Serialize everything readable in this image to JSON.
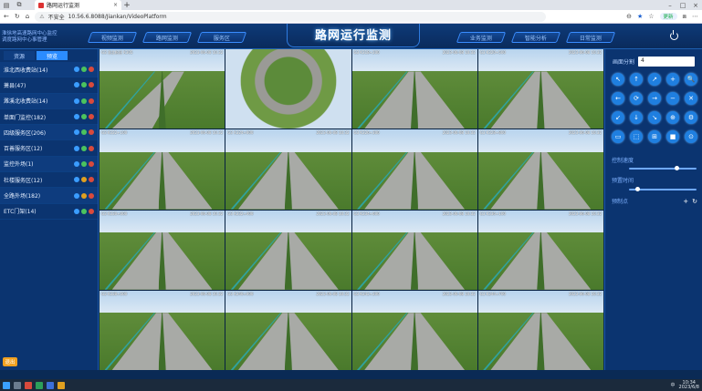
{
  "browser": {
    "tab_title": "路网运行监测",
    "security_label": "不安全",
    "url": "10.56.6.8088/Jiankan/VideoPlatform",
    "sync_pill": "更新"
  },
  "header": {
    "org_line1": "淮徐地高速路网中心监控",
    "org_line2": "调度路网中心事管理",
    "title": "路网运行监测",
    "nav_left": [
      "视频监测",
      "路网监测",
      "服务区"
    ],
    "nav_right": [
      "业务监测",
      "智能分析",
      "日常监测"
    ]
  },
  "sidebar": {
    "tabs": [
      "资源",
      "预览"
    ],
    "active_tab": "预览",
    "groups": [
      {
        "label": "淮北西收费站(14)",
        "dots": [
          "b",
          "g",
          "r"
        ]
      },
      {
        "label": "萧县(47)",
        "dots": [
          "b",
          "g",
          "r"
        ]
      },
      {
        "label": "濉溪北收费站(14)",
        "dots": [
          "b",
          "g",
          "r"
        ]
      },
      {
        "label": "单面门监控(182)",
        "dots": [
          "b",
          "g",
          "r"
        ]
      },
      {
        "label": "四级服务区(206)",
        "dots": [
          "b",
          "g",
          "r"
        ]
      },
      {
        "label": "百善服务区(12)",
        "dots": [
          "b",
          "g",
          "r"
        ]
      },
      {
        "label": "监控外场(1)",
        "dots": [
          "b",
          "g",
          "r"
        ]
      },
      {
        "label": "杜楼服务区(12)",
        "dots": [
          "b",
          "y",
          "r"
        ]
      },
      {
        "label": "全路外场(182)",
        "dots": [
          "b",
          "y",
          "r"
        ]
      },
      {
        "label": "ETC门架(14)",
        "dots": [
          "b",
          "g",
          "r"
        ]
      }
    ],
    "exit_label": "退出"
  },
  "cameras": [
    {
      "label": "G3 淮北枢纽 K305",
      "time": "2023-06-08 10:32",
      "style": "curve"
    },
    {
      "label": "",
      "time": "",
      "style": "fisheye"
    },
    {
      "label": "G3 K318+200",
      "time": "2023-06-08 10:32",
      "style": "straight"
    },
    {
      "label": "G3 K320+500",
      "time": "2023-06-08 10:32",
      "style": "straight"
    },
    {
      "label": "G3 K322+100",
      "time": "2023-06-08 10:32",
      "style": "straight"
    },
    {
      "label": "G3 K324+000",
      "time": "2023-06-08 10:32",
      "style": "straight"
    },
    {
      "label": "G3 K326+300",
      "time": "2023-06-08 10:32",
      "style": "straight"
    },
    {
      "label": "G3 K328+800",
      "time": "2023-06-08 10:32",
      "style": "straight"
    },
    {
      "label": "G3 K330+000",
      "time": "2023-06-08 10:32",
      "style": "straight"
    },
    {
      "label": "G3 K332+400",
      "time": "2023-06-08 10:32",
      "style": "straight"
    },
    {
      "label": "G3 K334+600",
      "time": "2023-06-08 10:32",
      "style": "straight"
    },
    {
      "label": "G3 K336+100",
      "time": "2023-06-08 10:32",
      "style": "straight"
    },
    {
      "label": "G3 K338+500",
      "time": "2023-06-08 10:32",
      "style": "straight"
    },
    {
      "label": "G3 K340+000",
      "time": "2023-06-08 10:32",
      "style": "straight"
    },
    {
      "label": "G3 K342+200",
      "time": "2023-06-08 10:32",
      "style": "straight"
    },
    {
      "label": "G3 K344+700",
      "time": "2023-06-08 10:32",
      "style": "straight"
    }
  ],
  "rpanel": {
    "split_label": "画面分割",
    "split_value": "4",
    "ptz_buttons": [
      "↖",
      "↑",
      "↗",
      "+",
      "🔍",
      "←",
      "⟳",
      "→",
      "−",
      "✕",
      "↙",
      "↓",
      "↘",
      "⊕",
      "⚙",
      "▭",
      "⬚",
      "⊞",
      "■",
      "⊙"
    ],
    "speed_label": "控制速度",
    "speed_value": 0.72,
    "preset_slider_label": "预置时间",
    "preset_slider_value": 0.1,
    "preset_label": "预制点",
    "preset_actions": [
      "+",
      "↻"
    ]
  },
  "taskbar": {
    "time": "10:34",
    "date": "2023/6/8",
    "lang": "中"
  }
}
